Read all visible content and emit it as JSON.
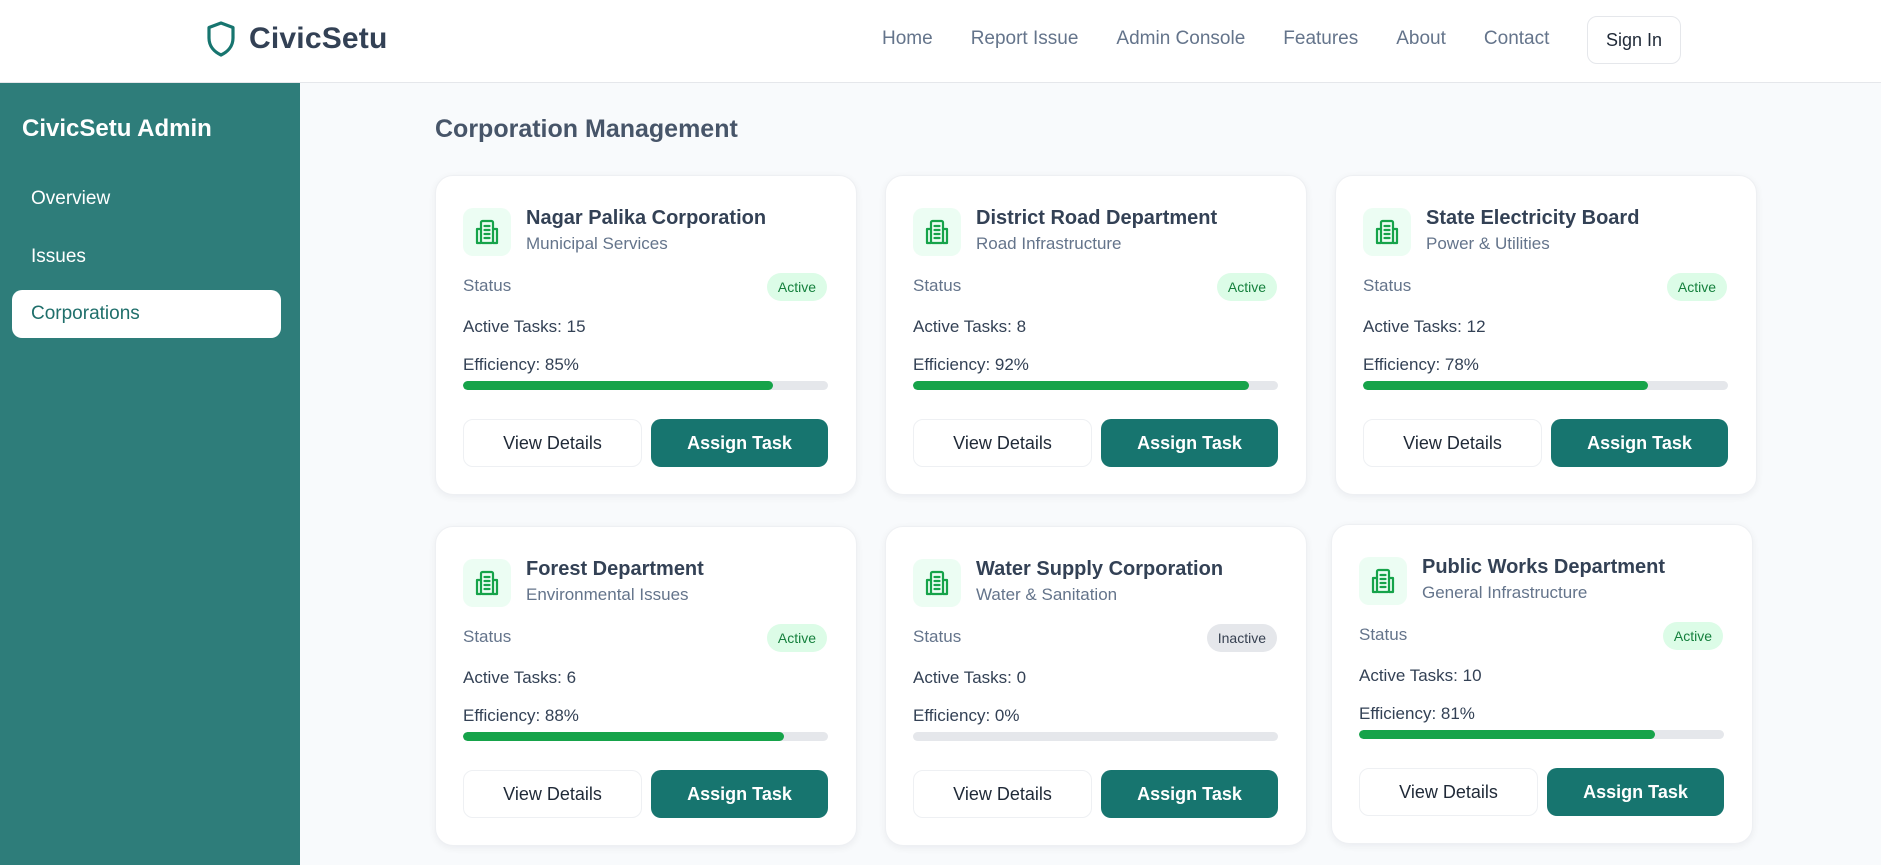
{
  "header": {
    "brand": "CivicSetu",
    "logo_icon": "shield-icon",
    "nav": [
      "Home",
      "Report Issue",
      "Admin Console",
      "Features",
      "About",
      "Contact"
    ],
    "sign_in": "Sign In"
  },
  "sidebar": {
    "title": "CivicSetu Admin",
    "items": [
      {
        "label": "Overview",
        "active": false
      },
      {
        "label": "Issues",
        "active": false
      },
      {
        "label": "Corporations",
        "active": true
      }
    ]
  },
  "main": {
    "title": "Corporation Management",
    "status_label": "Status",
    "view_label": "View Details",
    "assign_label": "Assign Task",
    "card_icon": "building-icon",
    "colors": {
      "accent": "#17756f",
      "sidebar": "#2e7d7a",
      "progress": "#16a34a",
      "active_badge_bg": "#dcfce7",
      "active_badge_text": "#15803d"
    },
    "corporations": [
      {
        "name": "Nagar Palika Corporation",
        "type": "Municipal Services",
        "status": "Active",
        "tasks": "Active Tasks: 15",
        "efficiency": "Efficiency: 85%",
        "efficiency_pct": 85
      },
      {
        "name": "District Road Department",
        "type": "Road Infrastructure",
        "status": "Active",
        "tasks": "Active Tasks: 8",
        "efficiency": "Efficiency: 92%",
        "efficiency_pct": 92
      },
      {
        "name": "State Electricity Board",
        "type": "Power & Utilities",
        "status": "Active",
        "tasks": "Active Tasks: 12",
        "efficiency": "Efficiency: 78%",
        "efficiency_pct": 78
      },
      {
        "name": "Forest Department",
        "type": "Environmental Issues",
        "status": "Active",
        "tasks": "Active Tasks: 6",
        "efficiency": "Efficiency: 88%",
        "efficiency_pct": 88
      },
      {
        "name": "Water Supply Corporation",
        "type": "Water & Sanitation",
        "status": "Inactive",
        "tasks": "Active Tasks: 0",
        "efficiency": "Efficiency: 0%",
        "efficiency_pct": 0
      },
      {
        "name": "Public Works Department",
        "type": "General Infrastructure",
        "status": "Active",
        "tasks": "Active Tasks: 10",
        "efficiency": "Efficiency: 81%",
        "efficiency_pct": 81
      }
    ]
  }
}
